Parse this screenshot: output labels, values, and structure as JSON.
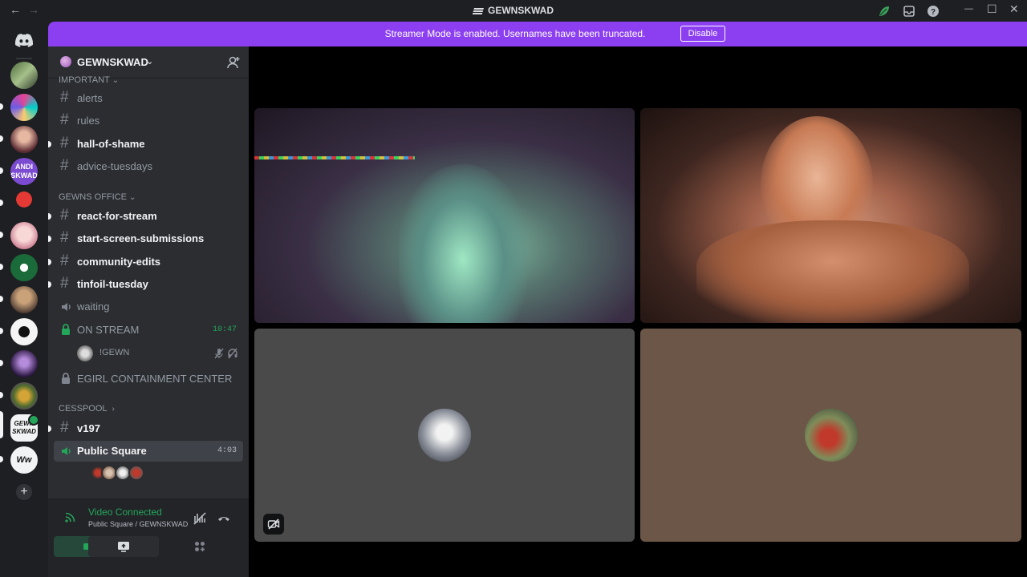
{
  "window": {
    "title": "GEWNSKWAD",
    "back_glyph": "←",
    "forward_glyph": "→",
    "minimize_glyph": "—",
    "maximize_glyph": "☐",
    "close_glyph": "✕"
  },
  "banner": {
    "text": "Streamer Mode is enabled. Usernames have been truncated.",
    "button": "Disable",
    "close_glyph": "✕",
    "color": "#8c3ff0"
  },
  "server": {
    "name": "GEWNSKWAD",
    "chevron": "⌄"
  },
  "sidebar": {
    "category_important": "IMPORTANT",
    "category_gewns_office": "GEWNS OFFICE",
    "category_cesspool": "CESSPOOL",
    "cat_arrow_down": "⌄",
    "cat_arrow_right": "›",
    "channels": [
      {
        "label": "alerts",
        "icon": "#"
      },
      {
        "label": "rules",
        "icon": "#"
      },
      {
        "label": "hall-of-shame",
        "icon": "#"
      },
      {
        "label": "advice-tuesdays",
        "icon": "#"
      },
      {
        "label": "react-for-stream",
        "icon": "#"
      },
      {
        "label": "start-screen-submissions",
        "icon": "#"
      },
      {
        "label": "community-edits",
        "icon": "#"
      },
      {
        "label": "tinfoil-tuesday",
        "icon": "#"
      },
      {
        "label": "waiting",
        "icon": "speaker-icon"
      },
      {
        "label": "ON STREAM",
        "icon": "lock-icon",
        "time": "10:47"
      },
      {
        "label": "EGIRL CONTAINMENT CENTER",
        "icon": "lock-icon"
      },
      {
        "label": "v197",
        "icon": "#"
      },
      {
        "label": "Public Square",
        "icon": "speaker-icon",
        "time": "4:03"
      }
    ],
    "voice_user": "!GEWN"
  },
  "voice_panel": {
    "status": "Video Connected",
    "location": "Public Square / GEWNSKWAD",
    "accent": "#23a55a"
  }
}
